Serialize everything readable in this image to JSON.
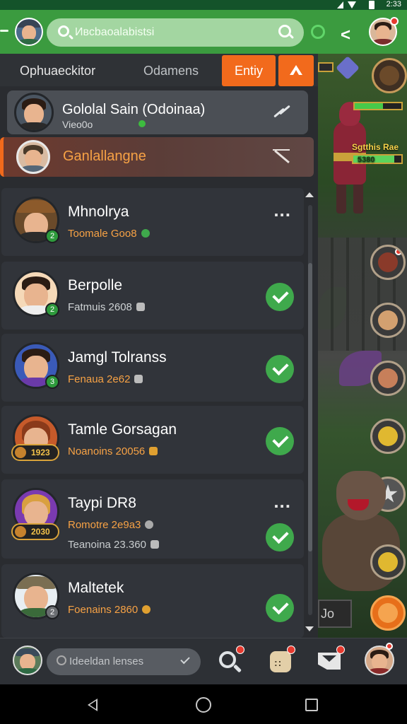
{
  "status_bar": {
    "time": "2:33"
  },
  "top_bar": {
    "search_text": "Ивсbаoаlаbistsi"
  },
  "tabs": {
    "tab1": "Ophuaeckitor",
    "tab2": "Odamens",
    "entry_button": "Entiy"
  },
  "pinned": [
    {
      "name": "Gololal Sain (Odoinaa)",
      "sub": "Vieo0o"
    },
    {
      "name": "Ganlallangne"
    }
  ],
  "friends": [
    {
      "name": "Mhnolrya",
      "status": "Toomale Goo8",
      "status_color": "#f7a245",
      "action": "more"
    },
    {
      "name": "Berpolle",
      "status": "Fatmuis 2608",
      "status_color": "#cfd3d5",
      "action": "check"
    },
    {
      "name": "Jamgl Tolranss",
      "status": "Fenaua 2e62",
      "status_color": "#f7a245",
      "action": "check"
    },
    {
      "name": "Tamle Gorsagan",
      "status": "Noanoins 20056",
      "status_color": "#f7a245",
      "action": "check",
      "rank": "1923"
    },
    {
      "name": "Taypi DR8",
      "status": "Romotre 2e9a3",
      "status_color": "#f7a245",
      "status2": "Teanoina 23.360",
      "action": "both",
      "rank": "2030"
    },
    {
      "name": "Maltetek",
      "status": "Foenains 2860",
      "status_color": "#f7a245",
      "action": "check"
    }
  ],
  "game": {
    "label": "Sgtthis Rae",
    "label2": "5380",
    "minimap": "Jo"
  },
  "bottom_bar": {
    "search_text": "Ideeldan lenses"
  },
  "icons": {
    "menu": "menu-icon",
    "search": "search-icon",
    "game": "game-icon",
    "share": "share-icon",
    "check": "check-icon",
    "more": "more-icon",
    "chat": "chat-icon",
    "mail": "mail-icon"
  },
  "colors": {
    "topbar": "#3b9b3f",
    "accent_orange": "#f26a1c",
    "check_green": "#3fa94c",
    "panel": "#2a2c30"
  }
}
